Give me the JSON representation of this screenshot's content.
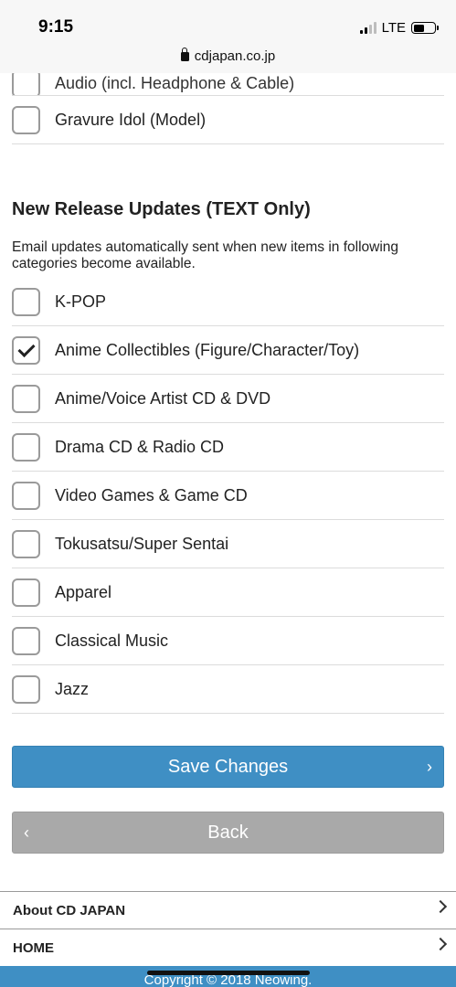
{
  "status_bar": {
    "time": "9:15",
    "network": "LTE",
    "url": "cdjapan.co.jp"
  },
  "top_items": [
    {
      "label": "Audio (incl. Headphone & Cable)",
      "checked": false
    },
    {
      "label": "Gravure Idol (Model)",
      "checked": false
    }
  ],
  "section": {
    "heading": "New Release Updates (TEXT Only)",
    "description": "Email updates automatically sent when new items in following categories become available."
  },
  "items": [
    {
      "label": "K-POP",
      "checked": false
    },
    {
      "label": "Anime Collectibles (Figure/Character/Toy)",
      "checked": true
    },
    {
      "label": "Anime/Voice Artist CD & DVD",
      "checked": false
    },
    {
      "label": "Drama CD & Radio CD",
      "checked": false
    },
    {
      "label": "Video Games & Game CD",
      "checked": false
    },
    {
      "label": "Tokusatsu/Super Sentai",
      "checked": false
    },
    {
      "label": "Apparel",
      "checked": false
    },
    {
      "label": "Classical Music",
      "checked": false
    },
    {
      "label": "Jazz",
      "checked": false
    }
  ],
  "buttons": {
    "save_label": "Save Changes",
    "back_label": "Back",
    "save_chevron": "›",
    "back_chevron": "‹"
  },
  "footer": {
    "links": [
      "About CD JAPAN",
      "HOME"
    ],
    "copyright": "Copyright © 2018 Neowing."
  },
  "colors": {
    "primary": "#3f8fc4",
    "secondary": "#a9a9a9"
  }
}
